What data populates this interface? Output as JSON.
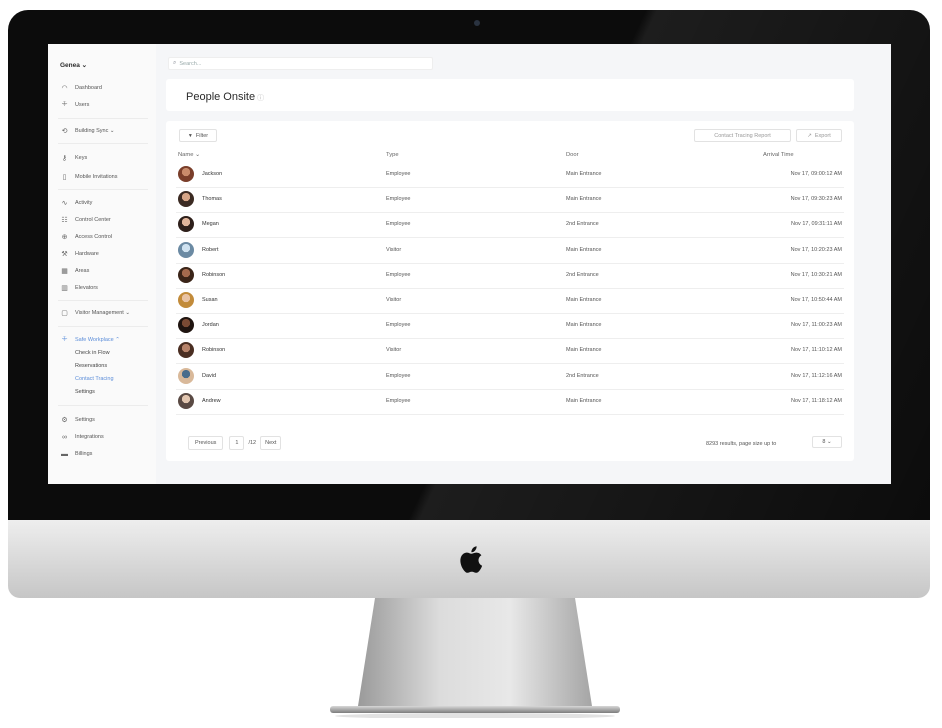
{
  "sidebar": {
    "brand": "Genea ⌄",
    "items": [
      {
        "label": "Dashboard",
        "icon": "dashboard-icon"
      },
      {
        "label": "Users",
        "icon": "users-icon"
      },
      {
        "label": "Building Sync ⌄",
        "icon": "building-sync-icon"
      },
      {
        "label": "Keys",
        "icon": "key-icon"
      },
      {
        "label": "Mobile Invitations",
        "icon": "mobile-icon"
      },
      {
        "label": "Activity",
        "icon": "activity-icon"
      },
      {
        "label": "Control Center",
        "icon": "sliders-icon"
      },
      {
        "label": "Access Control",
        "icon": "lock-icon"
      },
      {
        "label": "Hardware",
        "icon": "wrench-icon"
      },
      {
        "label": "Areas",
        "icon": "grid-icon"
      },
      {
        "label": "Elevators",
        "icon": "elevator-icon"
      },
      {
        "label": "Visitor Management ⌄",
        "icon": "visitor-icon"
      },
      {
        "label": "Safe Workplace ⌃",
        "icon": "people-icon"
      },
      {
        "label": "Settings",
        "icon": "gear-icon"
      },
      {
        "label": "Integrations",
        "icon": "link-icon"
      },
      {
        "label": "Billings",
        "icon": "card-icon"
      }
    ],
    "sub_items": [
      "Check in Flow",
      "Reservations",
      "Contact Tracing",
      "Settings"
    ]
  },
  "search": {
    "placeholder": "Search..."
  },
  "page": {
    "title": "People Onsite",
    "info_icon": "ⓘ"
  },
  "toolbar": {
    "filter_label": "Filter",
    "report_label": "Contact Tracing Report",
    "export_label": "Export"
  },
  "table": {
    "headers": {
      "name": "Name ⌄",
      "type": "Type",
      "door": "Door",
      "arrival": "Arrival Time"
    },
    "rows": [
      {
        "name": "Jackson",
        "type": "Employee",
        "door": "Main Entrance",
        "time": "Nov 17, 09:00:12 AM"
      },
      {
        "name": "Thomas",
        "type": "Employee",
        "door": "Main Entrance",
        "time": "Nov 17, 09:30:23 AM"
      },
      {
        "name": "Megan",
        "type": "Employee",
        "door": "2nd Entrance",
        "time": "Nov 17, 09:31:11 AM"
      },
      {
        "name": "Robert",
        "type": "Visitor",
        "door": "Main Entrance",
        "time": "Nov 17, 10:20:23 AM"
      },
      {
        "name": "Robinson",
        "type": "Employee",
        "door": "2nd Entrance",
        "time": "Nov 17, 10:30:21 AM"
      },
      {
        "name": "Susan",
        "type": "Visitor",
        "door": "Main Entrance",
        "time": "Nov 17, 10:50:44 AM"
      },
      {
        "name": "Jordan",
        "type": "Employee",
        "door": "Main Entrance",
        "time": "Nov 17, 11:00:23 AM"
      },
      {
        "name": "Robinson",
        "type": "Visitor",
        "door": "Main Entrance",
        "time": "Nov 17, 11:10:12 AM"
      },
      {
        "name": "David",
        "type": "Employee",
        "door": "2nd Entrance",
        "time": "Nov 17, 11:12:16 AM"
      },
      {
        "name": "Andrew",
        "type": "Employee",
        "door": "Main Entrance",
        "time": "Nov 17, 11:18:12 AM"
      }
    ]
  },
  "pagination": {
    "previous": "Previous",
    "page": "1",
    "total": "/12",
    "next": "Next",
    "results": "8293 results, page size up to",
    "page_size": "8 ⌄"
  },
  "colors": {
    "accent": "#5b8dd9",
    "bezel": "#0c0c0c",
    "screen_bg": "#f5f6f8"
  }
}
